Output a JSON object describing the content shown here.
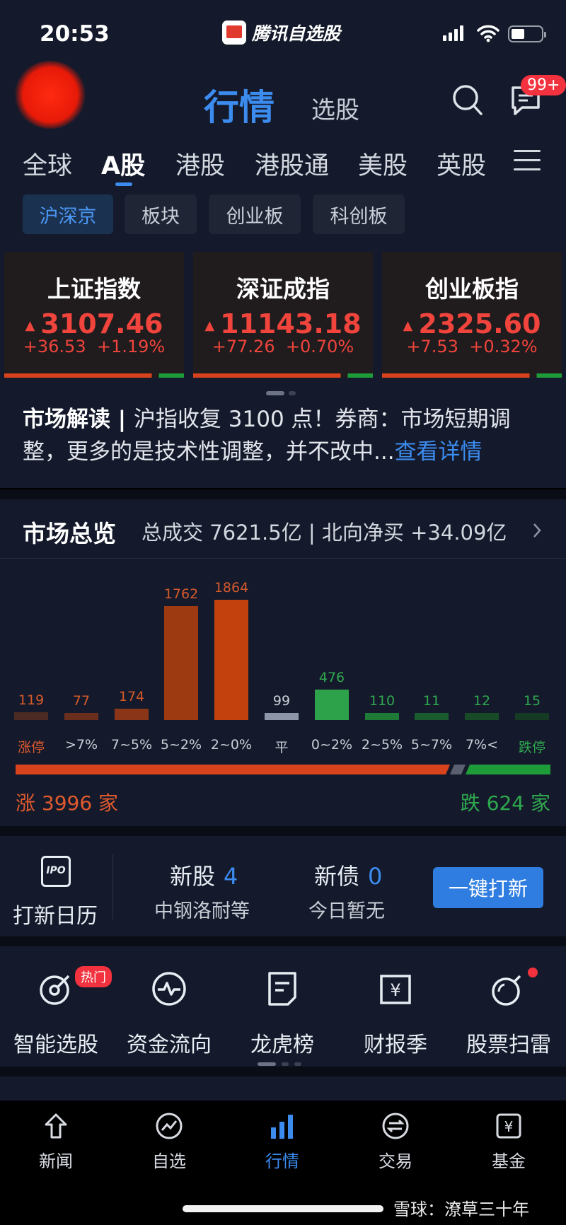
{
  "status": {
    "time": "20:53",
    "app_name": "腾讯自选股"
  },
  "header": {
    "nav_active": "行情",
    "nav_other": "选股",
    "msg_badge": "99+"
  },
  "market_tabs": [
    "全球",
    "A股",
    "港股",
    "港股通",
    "美股",
    "英股"
  ],
  "sub_tabs": [
    "沪深京",
    "板块",
    "创业板",
    "科创板"
  ],
  "indices": [
    {
      "name": "上证指数",
      "value": "3107.46",
      "change": "+36.53",
      "pct": "+1.19%"
    },
    {
      "name": "深证成指",
      "value": "11143.18",
      "change": "+77.26",
      "pct": "+0.70%"
    },
    {
      "name": "创业板指",
      "value": "2325.60",
      "change": "+7.53",
      "pct": "+0.32%"
    }
  ],
  "news": {
    "tag": "市场解读 | ",
    "text": "沪指收复 3100 点！券商：市场短期调整，更多的是技术性调整，并不改中...",
    "more": "查看详情"
  },
  "overview": {
    "title": "市场总览",
    "info": "总成交 7621.5亿 | 北向净买  +34.09亿",
    "up_label": "涨 3996 家",
    "down_label": "跌 624 家"
  },
  "chart_data": {
    "type": "bar",
    "categories": [
      "涨停",
      ">7%",
      "7~5%",
      "5~2%",
      "2~0%",
      "平",
      "0~2%",
      "2~5%",
      "5~7%",
      "7%<",
      "跌停"
    ],
    "values": [
      119,
      77,
      174,
      1762,
      1864,
      99,
      476,
      110,
      11,
      12,
      15
    ],
    "up_total": 3996,
    "down_total": 624,
    "colors": [
      "#4a2a22",
      "#6a2e1c",
      "#8a3418",
      "#9e3a12",
      "#c2410c",
      "#8e97aa",
      "#2ea24b",
      "#1f7a38",
      "#1a5c2e",
      "#184a28",
      "#163b24"
    ]
  },
  "ipo": {
    "label": "打新日历",
    "new_stock": "新股",
    "new_stock_count": "4",
    "new_stock_sub": "中钢洛耐等",
    "new_bond": "新债",
    "new_bond_count": "0",
    "new_bond_sub": "今日暂无",
    "button": "一键打新"
  },
  "tools": {
    "hot_badge": "热门",
    "items": [
      "智能选股",
      "资金流向",
      "龙虎榜",
      "财报季",
      "股票扫雷"
    ]
  },
  "bottom_nav": [
    "新闻",
    "自选",
    "行情",
    "交易",
    "基金"
  ],
  "watermark": "雪球：潦草三十年",
  "colors": {
    "accent": "#3c8cf0",
    "up": "#f0443c",
    "down": "#2fa84f",
    "bg": "#141a2b"
  }
}
